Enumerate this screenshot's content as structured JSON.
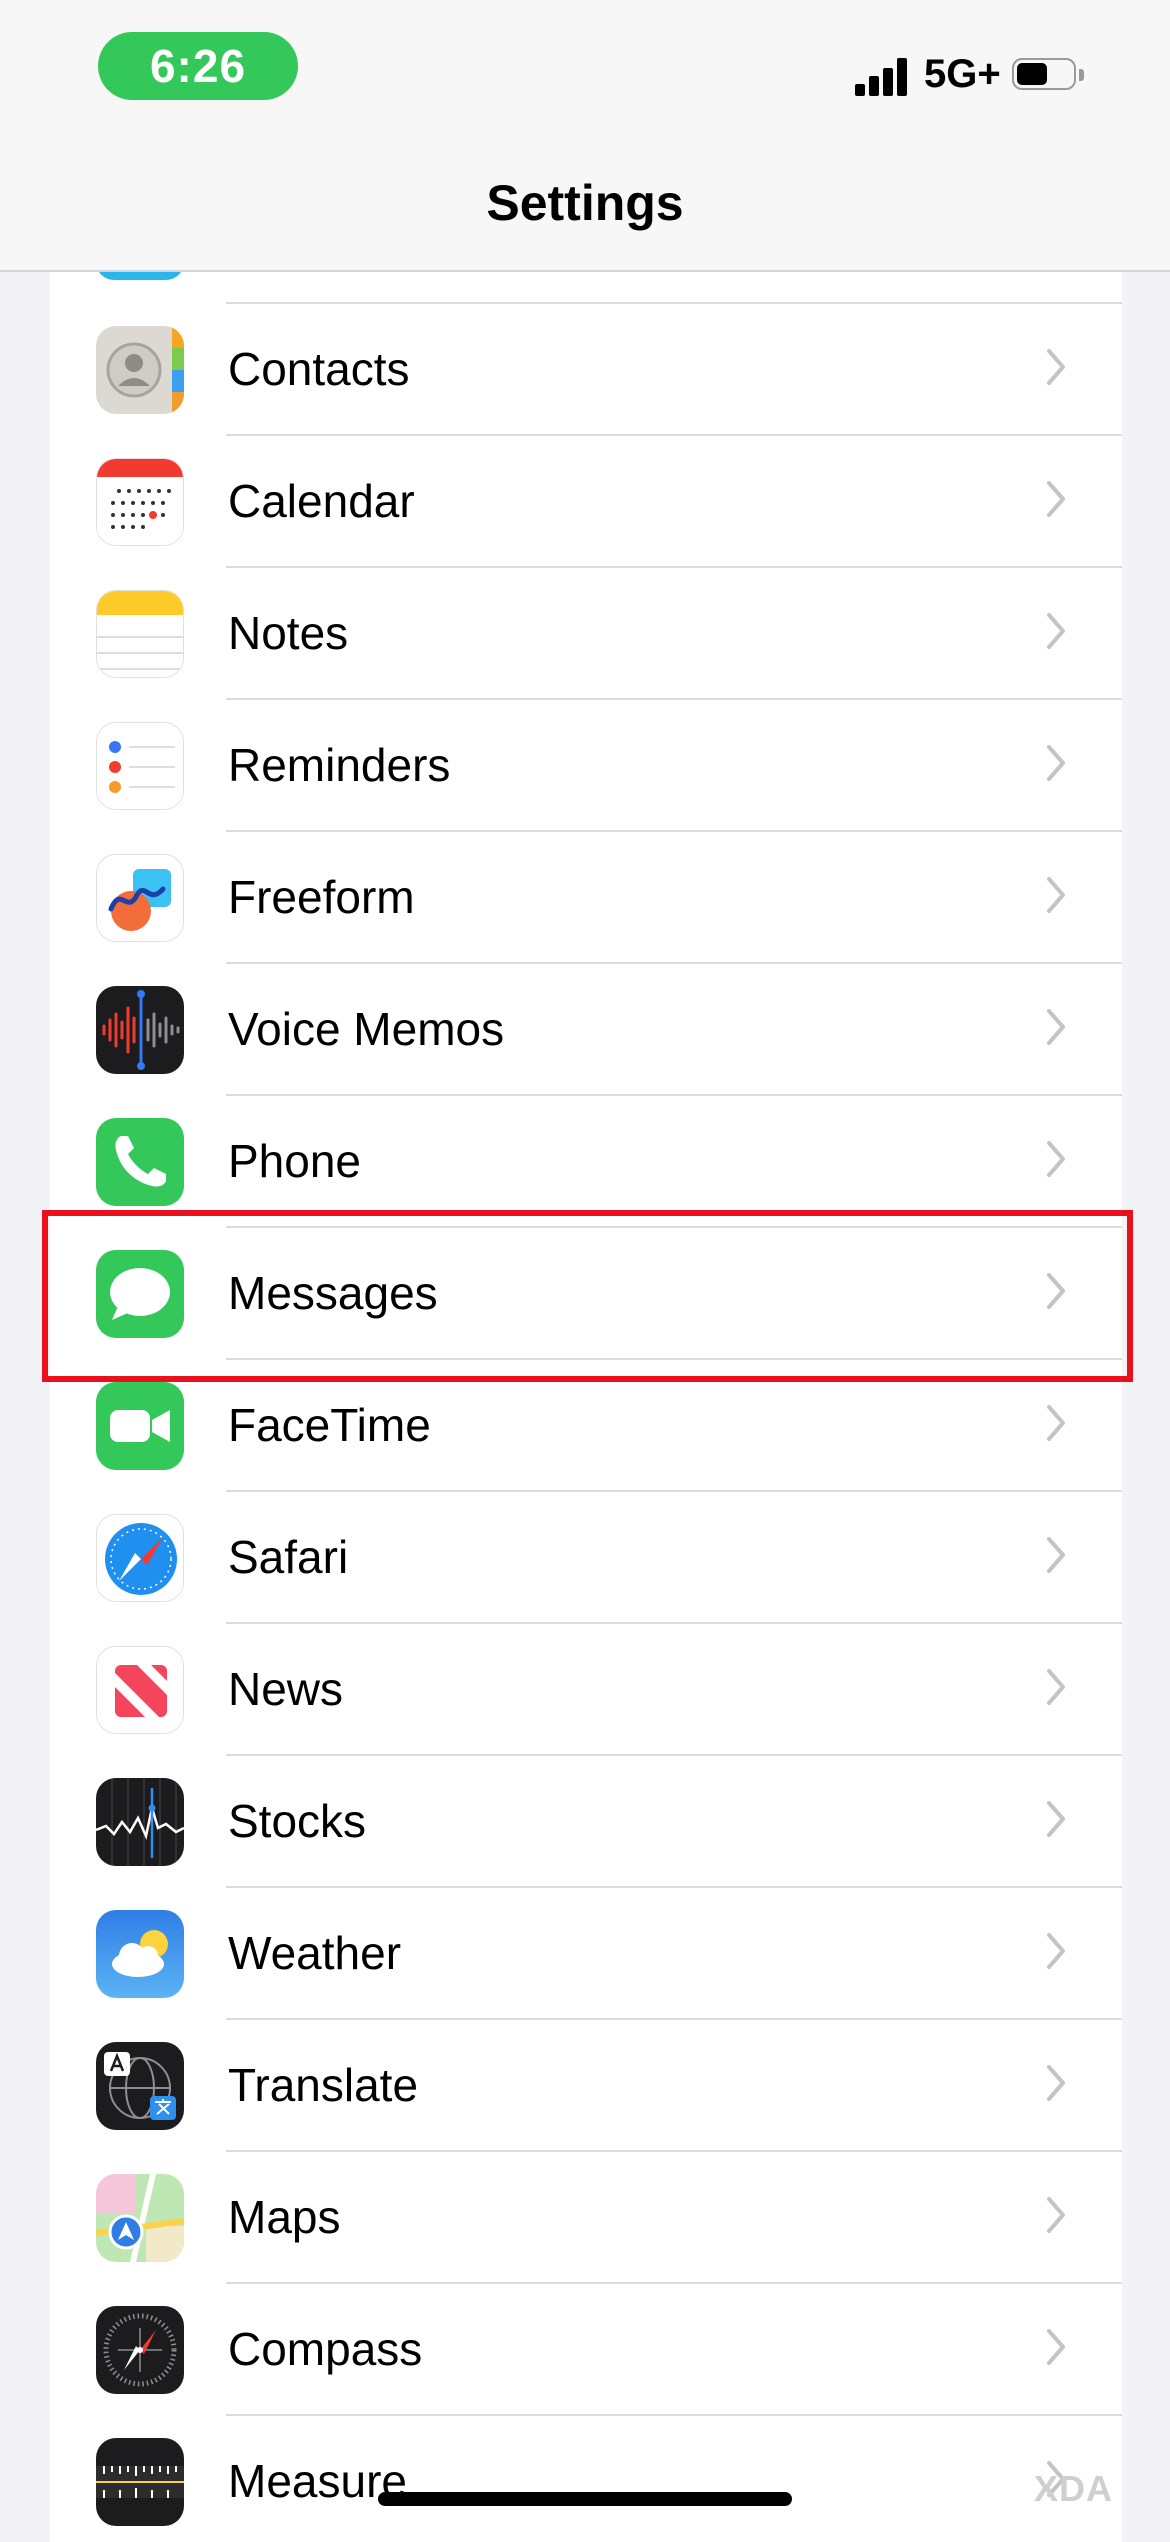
{
  "status_bar": {
    "time": "6:26",
    "network": "5G+",
    "time_pill_color": "#34c759"
  },
  "nav": {
    "title": "Settings"
  },
  "rows": [
    {
      "label": "Contacts",
      "icon": "contacts-icon"
    },
    {
      "label": "Calendar",
      "icon": "calendar-icon"
    },
    {
      "label": "Notes",
      "icon": "notes-icon"
    },
    {
      "label": "Reminders",
      "icon": "reminders-icon"
    },
    {
      "label": "Freeform",
      "icon": "freeform-icon"
    },
    {
      "label": "Voice Memos",
      "icon": "voice-memos-icon"
    },
    {
      "label": "Phone",
      "icon": "phone-icon"
    },
    {
      "label": "Messages",
      "icon": "messages-icon",
      "highlighted": true
    },
    {
      "label": "FaceTime",
      "icon": "facetime-icon"
    },
    {
      "label": "Safari",
      "icon": "safari-icon"
    },
    {
      "label": "News",
      "icon": "news-icon"
    },
    {
      "label": "Stocks",
      "icon": "stocks-icon"
    },
    {
      "label": "Weather",
      "icon": "weather-icon"
    },
    {
      "label": "Translate",
      "icon": "translate-icon"
    },
    {
      "label": "Maps",
      "icon": "maps-icon"
    },
    {
      "label": "Compass",
      "icon": "compass-icon"
    },
    {
      "label": "Measure",
      "icon": "measure-icon"
    }
  ],
  "highlight_color": "#e8111c",
  "watermark": "XDA"
}
